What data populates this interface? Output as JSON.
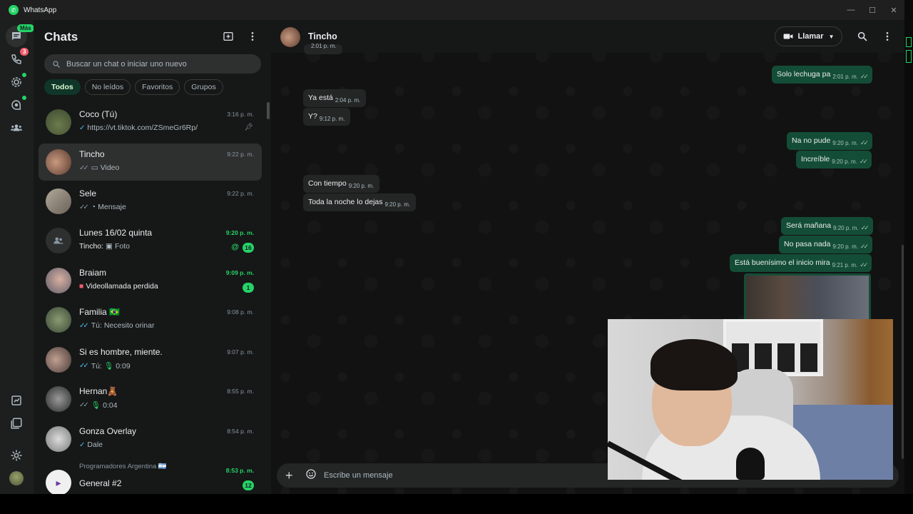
{
  "window": {
    "title": "WhatsApp"
  },
  "rail": {
    "chats_badge": "Más",
    "calls_badge": "3"
  },
  "list": {
    "title": "Chats",
    "search_placeholder": "Buscar un chat o iniciar uno nuevo",
    "filters": [
      "Todos",
      "No leídos",
      "Favoritos",
      "Grupos"
    ],
    "chats": [
      {
        "name": "Coco (Tú)",
        "time": "3:16 p. m.",
        "preview": "https://vt.tiktok.com/ZSmeGr6Rp/"
      },
      {
        "name": "Tincho",
        "time": "9:22 p. m.",
        "preview": "Video"
      },
      {
        "name": "Sele",
        "time": "9:22 p. m.",
        "preview": "Mensaje"
      },
      {
        "name": "Lunes 16/02 quinta",
        "time": "9:20 p. m.",
        "sender": "Tincho:",
        "preview": "Foto",
        "unread": "16"
      },
      {
        "name": "Braiam",
        "time": "9:09 p. m.",
        "preview": "Videollamada perdida",
        "unread": "1"
      },
      {
        "name": "Familia 🇧🇷",
        "time": "9:08 p. m.",
        "preview": "Tú: Necesito orinar"
      },
      {
        "name": "Si es hombre, miente.",
        "time": "9:07 p. m.",
        "sender": "Tú:",
        "preview": "0:09"
      },
      {
        "name": "Hernan🧸",
        "time": "8:55 p. m.",
        "preview": "0:04"
      },
      {
        "name": "Gonza Overlay",
        "time": "8:54 p. m.",
        "preview": "Dale"
      },
      {
        "name": "General #2",
        "community": "Programadores Argentina 🇦🇷",
        "time": "8:53 p. m.",
        "unread": "12"
      }
    ]
  },
  "conversation": {
    "contact": "Tincho",
    "call_label": "Llamar",
    "composer_placeholder": "Escribe un mensaje",
    "cut_time": "2:01 p. m.",
    "messages": [
      {
        "dir": "out",
        "text": "Solo lechuga pa",
        "time": "2:01 p. m."
      },
      {
        "dir": "in",
        "text": "Ya está",
        "time": "2:04 p. m."
      },
      {
        "dir": "in",
        "text": "Y?",
        "time": "9:12 p. m."
      },
      {
        "dir": "out",
        "text": "Na no pude",
        "time": "9:20 p. m."
      },
      {
        "dir": "out",
        "text": "Increíble",
        "time": "9:20 p. m."
      },
      {
        "dir": "in",
        "text": "Con tiempo",
        "time": "9:20 p. m."
      },
      {
        "dir": "in",
        "text": "Toda la noche lo dejas",
        "time": "9:20 p. m."
      },
      {
        "dir": "out",
        "text": "Será mañana",
        "time": "9:20 p. m."
      },
      {
        "dir": "out",
        "text": "No pasa nada",
        "time": "9:20 p. m."
      },
      {
        "dir": "out",
        "text": "Está buenísimo el inicio mira",
        "time": "9:21 p. m."
      }
    ]
  },
  "colors": {
    "accent": "#25d366",
    "outgoing": "#144d37",
    "incoming": "#242626",
    "read_tick": "#53bdeb"
  }
}
